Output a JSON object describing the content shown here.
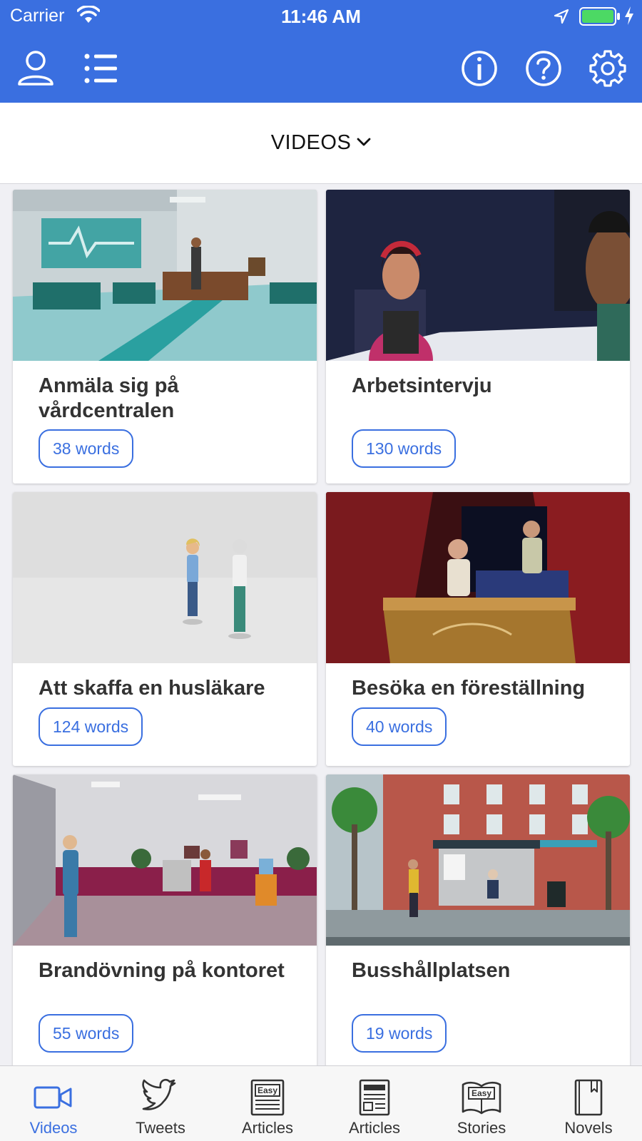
{
  "status_bar": {
    "carrier": "Carrier",
    "time": "11:46 AM"
  },
  "nav": {
    "left_icons": [
      "person-icon",
      "list-icon"
    ],
    "right_icons": [
      "info-icon",
      "help-icon",
      "gear-icon"
    ]
  },
  "section": {
    "title": "VIDEOS"
  },
  "cards": [
    {
      "title": "Anmäla sig på vårdcentralen",
      "words": "38 words"
    },
    {
      "title": "Arbetsintervju",
      "words": "130 words"
    },
    {
      "title": "Att skaffa en husläkare",
      "words": "124 words"
    },
    {
      "title": "Besöka en föreställning",
      "words": "40 words"
    },
    {
      "title": "Brandövning på kontoret",
      "words": "55 words"
    },
    {
      "title": "Busshållplatsen",
      "words": "19 words"
    }
  ],
  "tabs": [
    {
      "label": "Videos",
      "icon": "video-camera-icon",
      "active": true
    },
    {
      "label": "Tweets",
      "icon": "twitter-bird-icon"
    },
    {
      "label": "Articles",
      "icon": "easy-newspaper-icon",
      "badge": "Easy"
    },
    {
      "label": "Articles",
      "icon": "newspaper-icon"
    },
    {
      "label": "Stories",
      "icon": "easy-book-icon",
      "badge": "Easy"
    },
    {
      "label": "Novels",
      "icon": "bookmarked-book-icon"
    }
  ],
  "colors": {
    "accent": "#3a6fe0",
    "battery": "#4cd964"
  }
}
